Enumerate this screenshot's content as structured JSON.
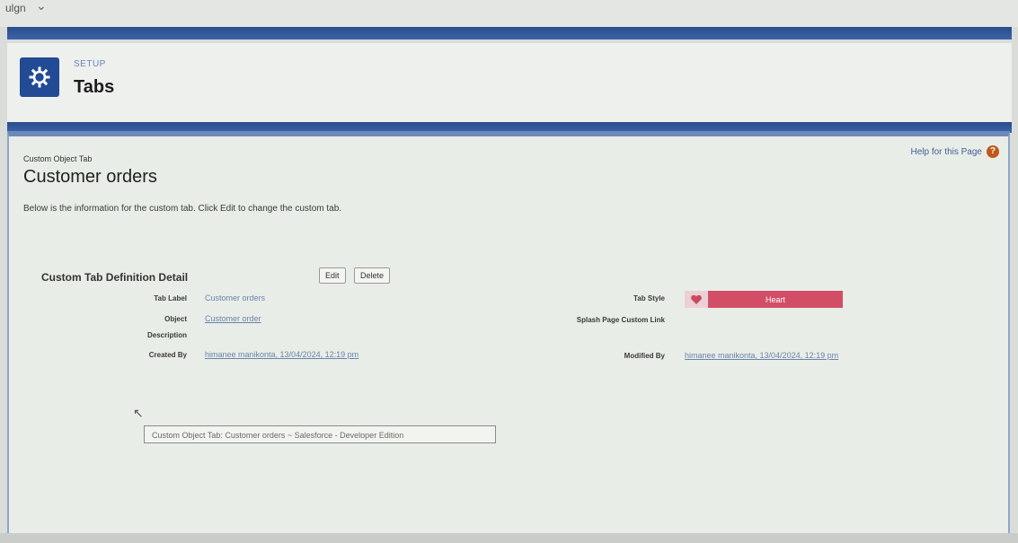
{
  "browser": {
    "crumb": "ulgn",
    "chevron": "⌄"
  },
  "header": {
    "kicker": "SETUP",
    "title": "Tabs",
    "icon": "gear-icon"
  },
  "page": {
    "kicker": "Custom Object Tab",
    "title": "Customer orders",
    "intro": "Below is the information for the custom tab. Click Edit to change the custom tab.",
    "help_label": "Help for this Page",
    "help_glyph": "?"
  },
  "detail": {
    "section_title": "Custom Tab Definition Detail",
    "edit_label": "Edit",
    "delete_label": "Delete",
    "tab_label": {
      "label": "Tab Label",
      "value": "Customer orders"
    },
    "object": {
      "label": "Object",
      "value": "Customer order"
    },
    "description": {
      "label": "Description",
      "value": ""
    },
    "created_by": {
      "label": "Created By",
      "value": "himanee manikonta, 13/04/2024, 12:19 pm"
    },
    "tab_style": {
      "label": "Tab Style",
      "value": "Heart",
      "icon": "heart-icon",
      "color": "#d24e66"
    },
    "splash": {
      "label": "Splash Page Custom Link",
      "value": ""
    },
    "modified_by": {
      "label": "Modified By",
      "value": "himanee manikonta, 13/04/2024, 12:19 pm"
    }
  },
  "tooltip": "Custom Object Tab: Customer orders ~ Salesforce - Developer Edition",
  "colors": {
    "brand_blue": "#234a94",
    "band_blue": "#2b4c8c",
    "panel_bg": "#e9ede8"
  }
}
